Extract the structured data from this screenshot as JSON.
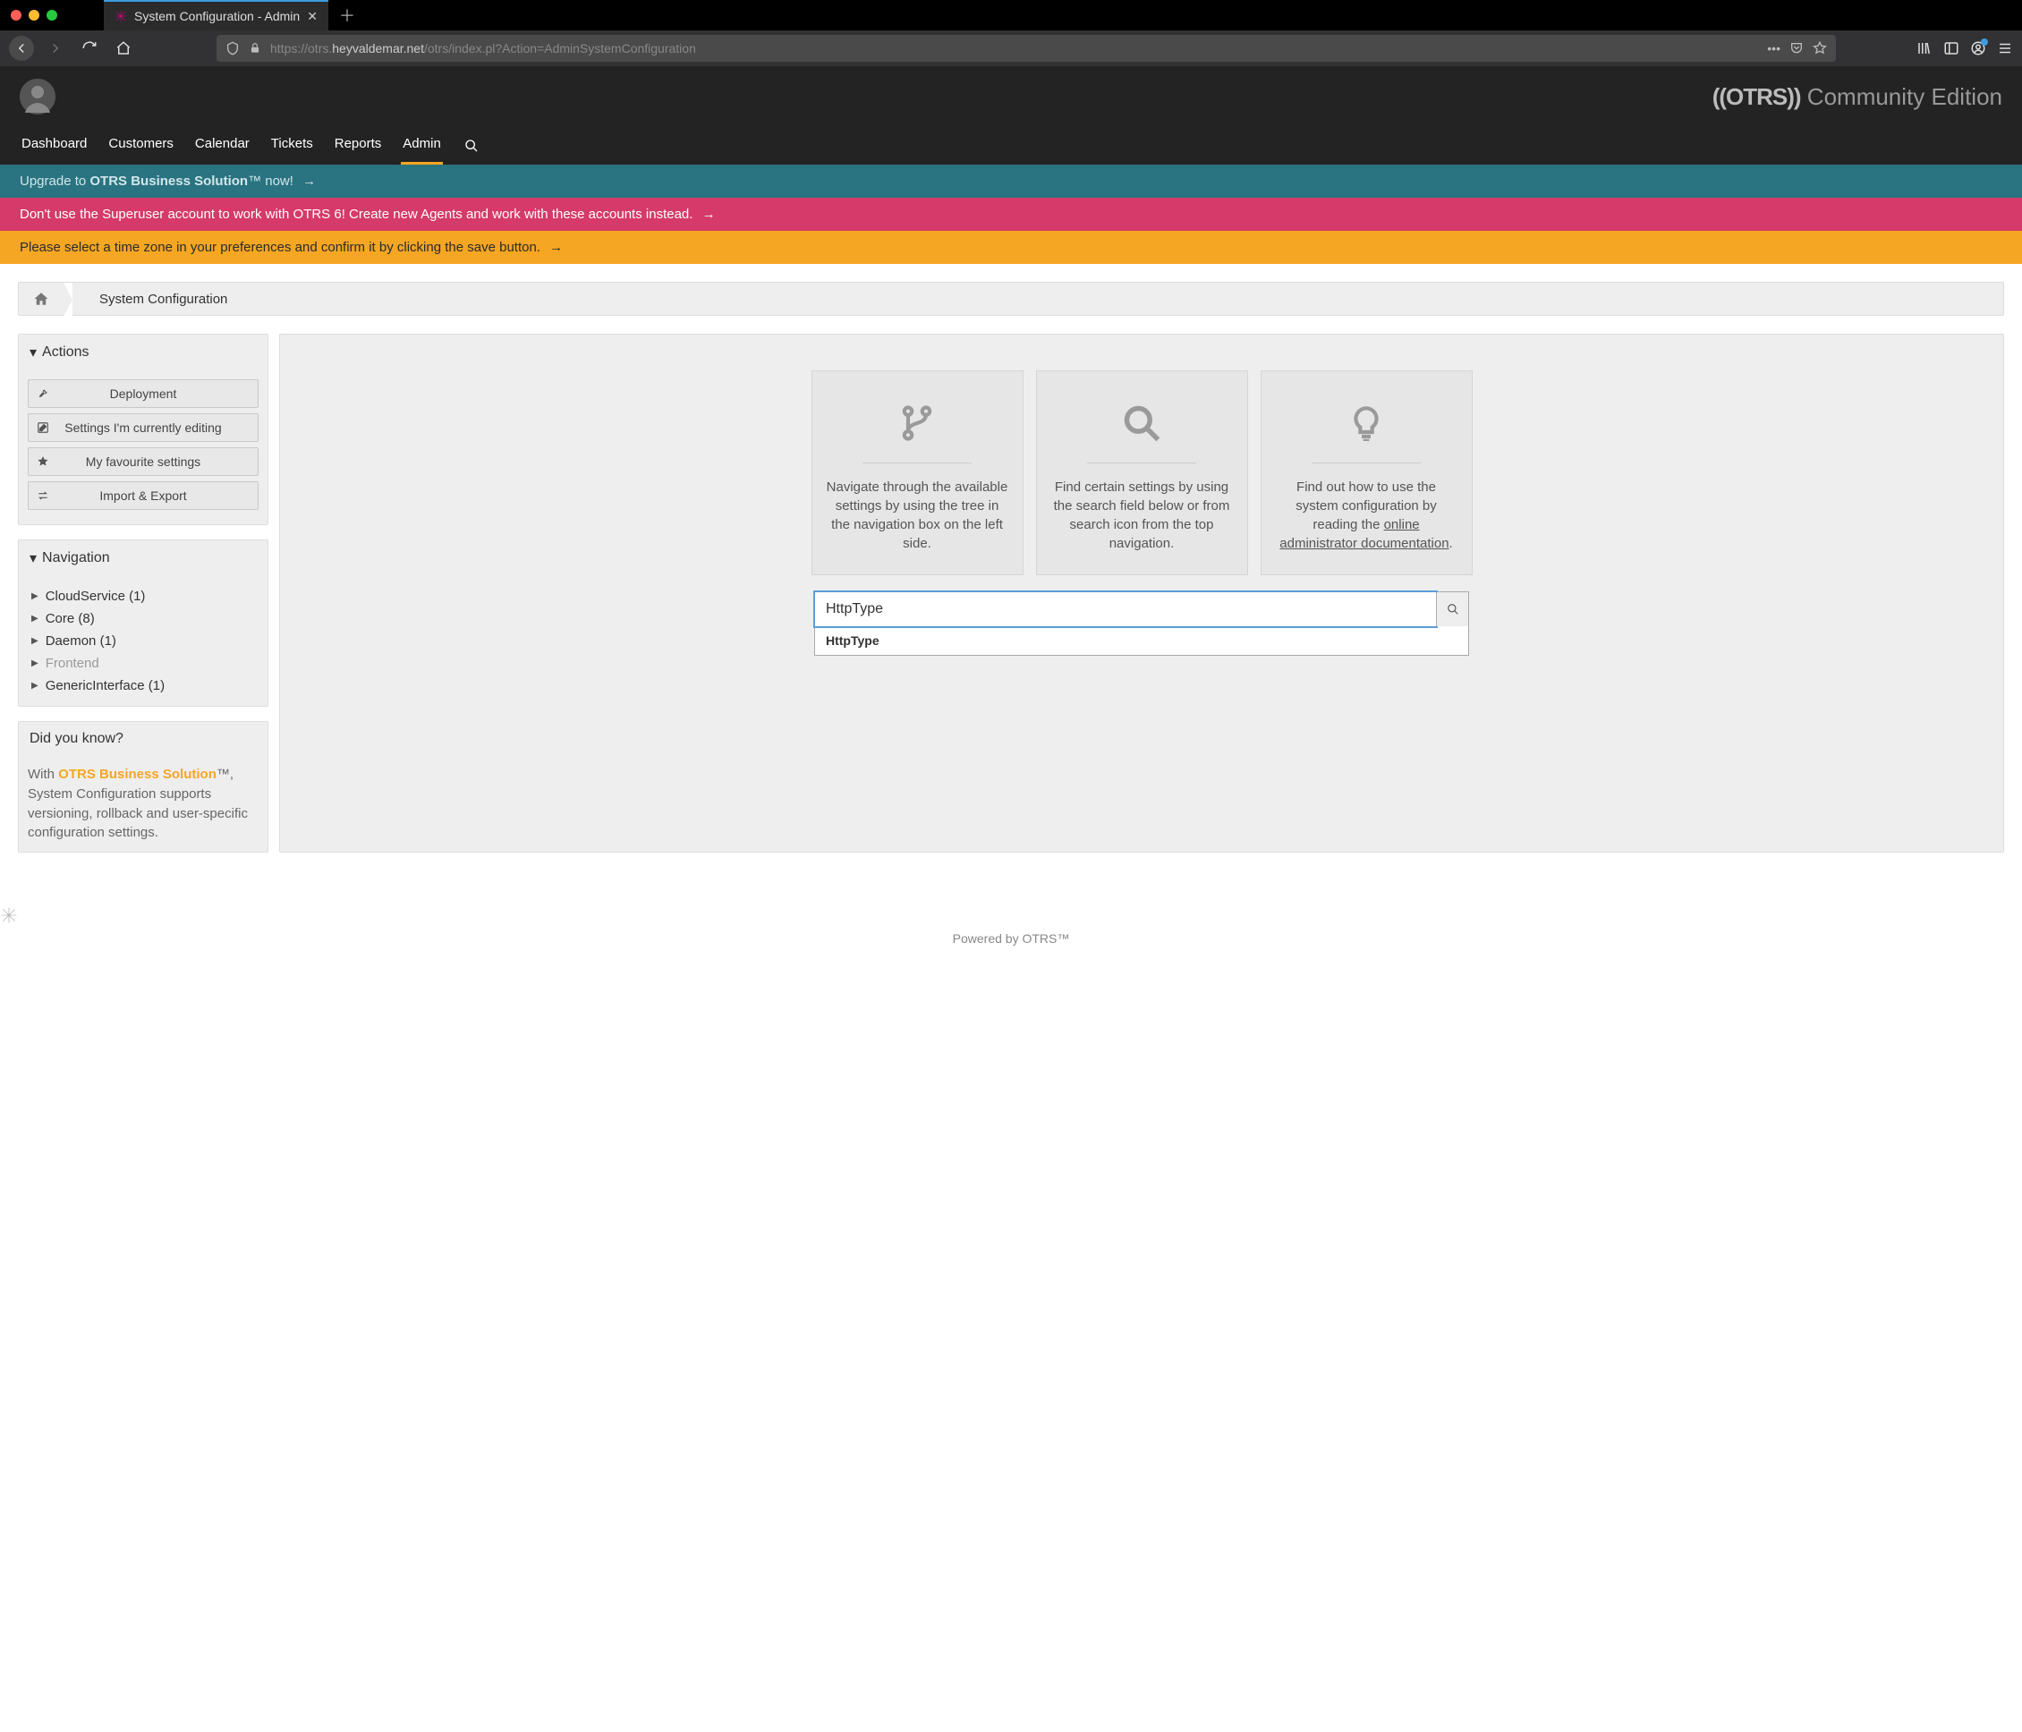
{
  "browser": {
    "tab_title": "System Configuration - Admin",
    "url_prefix": "https://otrs.",
    "url_host": "heyvaldemar.net",
    "url_path": "/otrs/index.pl?Action=AdminSystemConfiguration"
  },
  "brand": {
    "logo": "((OTRS))",
    "edition": "Community Edition"
  },
  "nav": {
    "items": [
      "Dashboard",
      "Customers",
      "Calendar",
      "Tickets",
      "Reports",
      "Admin"
    ],
    "active_index": 5
  },
  "notices": {
    "upgrade_pre": "Upgrade to ",
    "upgrade_strong": "OTRS Business Solution",
    "upgrade_post": "™ now! ",
    "superuser": "Don't use the Superuser account to work with OTRS 6! Create new Agents and work with these accounts instead. ",
    "timezone": "Please select a time zone in your preferences and confirm it by clicking the save button. "
  },
  "breadcrumb": {
    "title": "System Configuration"
  },
  "actions": {
    "title": "Actions",
    "items": [
      {
        "label": "Deployment",
        "icon": "rocket"
      },
      {
        "label": "Settings I'm currently editing",
        "icon": "edit"
      },
      {
        "label": "My favourite settings",
        "icon": "star"
      },
      {
        "label": "Import & Export",
        "icon": "swap"
      }
    ]
  },
  "navigation": {
    "title": "Navigation",
    "items": [
      {
        "label": "CloudService (1)",
        "muted": false
      },
      {
        "label": "Core (8)",
        "muted": false
      },
      {
        "label": "Daemon (1)",
        "muted": false
      },
      {
        "label": "Frontend",
        "muted": true
      },
      {
        "label": "GenericInterface (1)",
        "muted": false
      }
    ]
  },
  "dyk": {
    "title": "Did you know?",
    "pre": "With ",
    "obs": "OTRS Business Solution",
    "post": "™, System Configuration supports versioning, rollback and user-specific configuration settings."
  },
  "cards": {
    "tree": "Navigate through the available settings by using the tree in the navigation box on the left side.",
    "search": "Find certain settings by using the search field below or from search icon from the top navigation.",
    "help_pre": "Find out how to use the system configuration by reading the ",
    "help_link": "online administrator documentation",
    "help_post": "."
  },
  "search": {
    "value": "HttpType",
    "suggestion": "HttpType"
  },
  "footer": {
    "powered": "Powered by OTRS™"
  }
}
